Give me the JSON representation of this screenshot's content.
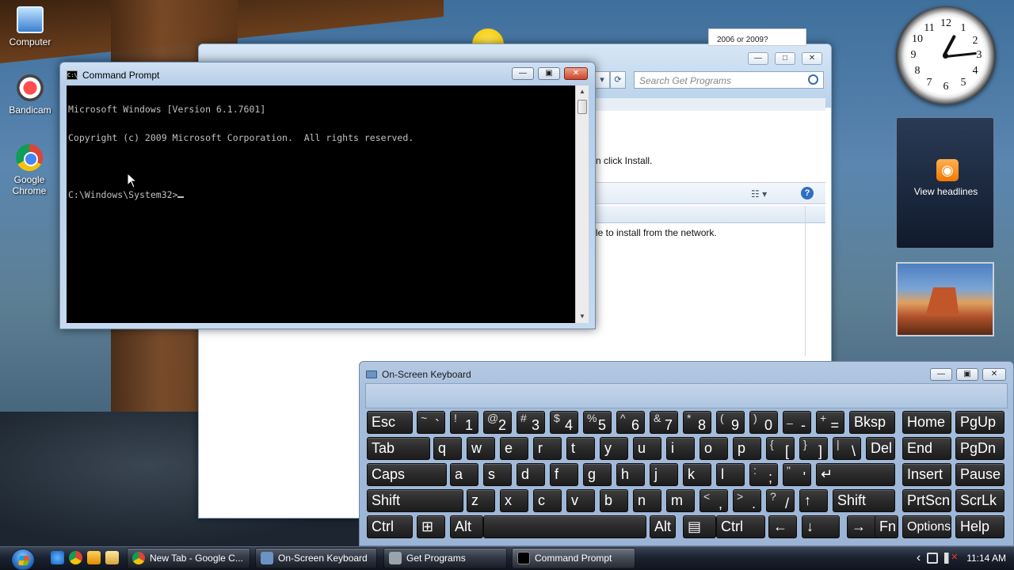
{
  "desktop": {
    "icons": [
      {
        "label": "Computer"
      },
      {
        "label": "Bandicam"
      },
      {
        "label": "Google Chrome"
      }
    ]
  },
  "get_programs": {
    "snippet_text": "2006 or 2009?",
    "search_placeholder": "Search Get Programs",
    "install_text": "n click Install.",
    "network_text": "le to install from the network.",
    "help_label": "?"
  },
  "cmd": {
    "title": "Command Prompt",
    "icon_text": "C:\\_",
    "lines": [
      "Microsoft Windows [Version 6.1.7601]",
      "Copyright (c) 2009 Microsoft Corporation.  All rights reserved.",
      "",
      "C:\\Windows\\System32>"
    ]
  },
  "gadgets": {
    "clock_numbers": [
      "12",
      "1",
      "2",
      "3",
      "4",
      "5",
      "6",
      "7",
      "8",
      "9",
      "10",
      "11"
    ],
    "feed_label": "View headlines"
  },
  "osk": {
    "title": "On-Screen Keyboard",
    "rows": [
      [
        {
          "label": "Esc"
        },
        {
          "sup": "~",
          "sub": "`"
        },
        {
          "sup": "!",
          "sub": "1"
        },
        {
          "sup": "@",
          "sub": "2"
        },
        {
          "sup": "#",
          "sub": "3"
        },
        {
          "sup": "$",
          "sub": "4"
        },
        {
          "sup": "%",
          "sub": "5"
        },
        {
          "sup": "^",
          "sub": "6"
        },
        {
          "sup": "&",
          "sub": "7"
        },
        {
          "sup": "*",
          "sub": "8"
        },
        {
          "sup": "(",
          "sub": "9"
        },
        {
          "sup": ")",
          "sub": "0"
        },
        {
          "sup": "_",
          "sub": "-"
        },
        {
          "sup": "+",
          "sub": "="
        },
        {
          "label": "Bksp"
        },
        {
          "label": "Home"
        },
        {
          "label": "PgUp"
        }
      ],
      [
        {
          "label": "Tab"
        },
        {
          "label": "q"
        },
        {
          "label": "w"
        },
        {
          "label": "e"
        },
        {
          "label": "r"
        },
        {
          "label": "t"
        },
        {
          "label": "y"
        },
        {
          "label": "u"
        },
        {
          "label": "i"
        },
        {
          "label": "o"
        },
        {
          "label": "p"
        },
        {
          "sup": "{",
          "sub": "["
        },
        {
          "sup": "}",
          "sub": "]"
        },
        {
          "sup": "|",
          "sub": "\\"
        },
        {
          "label": "Del"
        },
        {
          "label": "End"
        },
        {
          "label": "PgDn"
        }
      ],
      [
        {
          "label": "Caps"
        },
        {
          "label": "a"
        },
        {
          "label": "s"
        },
        {
          "label": "d"
        },
        {
          "label": "f"
        },
        {
          "label": "g"
        },
        {
          "label": "h"
        },
        {
          "label": "j"
        },
        {
          "label": "k"
        },
        {
          "label": "l"
        },
        {
          "sup": ":",
          "sub": ";"
        },
        {
          "sup": "\"",
          "sub": "'"
        },
        {
          "label": "↵"
        },
        {
          "label": "Insert"
        },
        {
          "label": "Pause"
        }
      ],
      [
        {
          "label": "Shift"
        },
        {
          "label": "z"
        },
        {
          "label": "x"
        },
        {
          "label": "c"
        },
        {
          "label": "v"
        },
        {
          "label": "b"
        },
        {
          "label": "n"
        },
        {
          "label": "m"
        },
        {
          "sup": "<",
          "sub": ","
        },
        {
          "sup": ">",
          "sub": "."
        },
        {
          "sup": "?",
          "sub": "/"
        },
        {
          "label": "↑"
        },
        {
          "label": "Shift"
        },
        {
          "label": "PrtScn"
        },
        {
          "label": "ScrLk"
        }
      ],
      [
        {
          "label": "Ctrl"
        },
        {
          "label": "⊞"
        },
        {
          "label": "Alt"
        },
        {
          "label": ""
        },
        {
          "label": "Alt"
        },
        {
          "label": "▤"
        },
        {
          "label": "Ctrl"
        },
        {
          "label": "←"
        },
        {
          "label": "↓"
        },
        {
          "label": "→"
        },
        {
          "label": "Fn"
        },
        {
          "label": "Options"
        },
        {
          "label": "Help"
        }
      ]
    ]
  },
  "taskbar": {
    "tasks": [
      {
        "label": "New Tab - Google C...",
        "icon_color": "#e9b23a"
      },
      {
        "label": "On-Screen Keyboard",
        "icon_color": "#6b93c4"
      },
      {
        "label": "Get Programs",
        "icon_color": "#9aa4ad"
      },
      {
        "label": "Command Prompt",
        "icon_color": "#000000"
      }
    ],
    "time": "11:14 AM",
    "tray_expand": "‹"
  },
  "colors": {
    "accent_blue": "#2f6fc1",
    "close_red": "#c9452a",
    "key_dark": "#2a2a2a"
  }
}
